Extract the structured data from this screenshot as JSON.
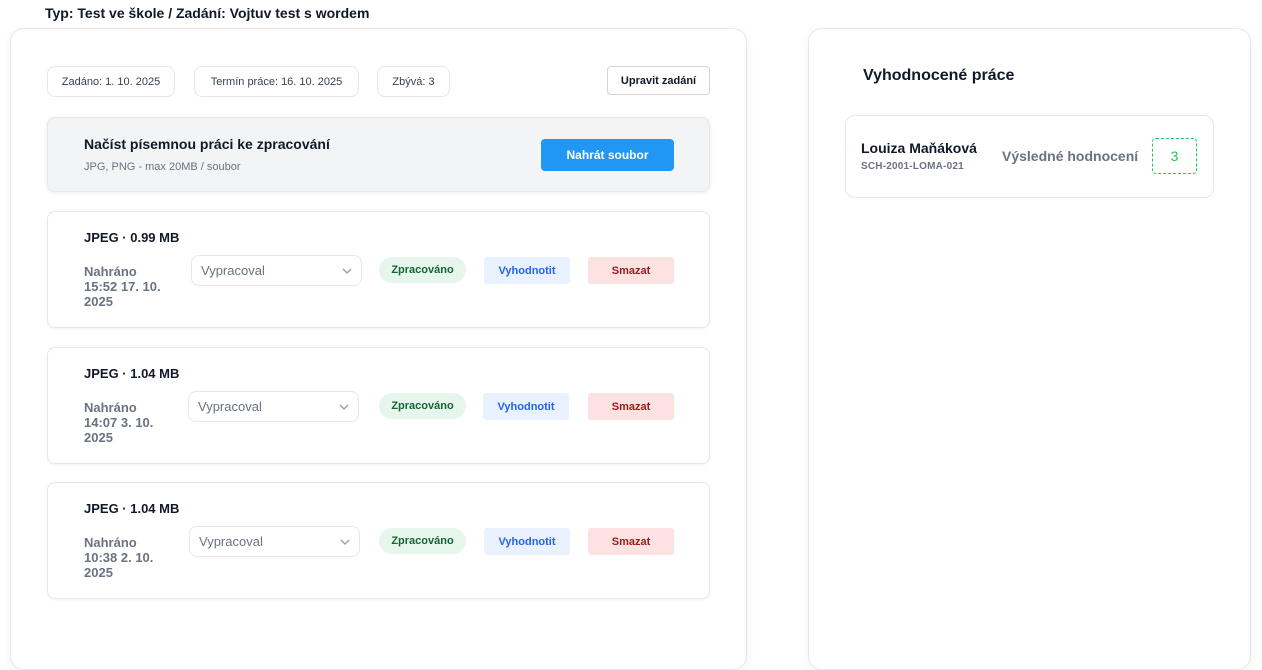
{
  "breadcrumb": "Typ: Test ve škole / Zadání: Vojtuv test s wordem",
  "assignment": {
    "assigned": "Zadáno: 1. 10. 2025",
    "deadline": "Termín práce: 16. 10. 2025",
    "remaining": "Zbývá: 3",
    "edit_label": "Upravit zadání"
  },
  "upload": {
    "title": "Načíst písemnou práci ke zpracování",
    "subtitle": "JPG, PNG - max 20MB / soubor",
    "button_label": "Nahrát soubor"
  },
  "files": [
    {
      "title": "JPEG · 0.99 MB",
      "uploaded_line1": "Nahráno",
      "uploaded_line2": "15:52 17. 10.",
      "uploaded_line3": "2025",
      "author_placeholder": "Vypracoval",
      "status": "Zpracováno",
      "evaluate_label": "Vyhodnotit",
      "delete_label": "Smazat"
    },
    {
      "title": "JPEG · 1.04 MB",
      "uploaded_line1": "Nahráno",
      "uploaded_line2": "14:07 3. 10.",
      "uploaded_line3": "2025",
      "author_placeholder": "Vypracoval",
      "status": "Zpracováno",
      "evaluate_label": "Vyhodnotit",
      "delete_label": "Smazat"
    },
    {
      "title": "JPEG · 1.04 MB",
      "uploaded_line1": "Nahráno",
      "uploaded_line2": "10:38 2. 10.",
      "uploaded_line3": "2025",
      "author_placeholder": "Vypracoval",
      "status": "Zpracováno",
      "evaluate_label": "Vyhodnotit",
      "delete_label": "Smazat"
    }
  ],
  "evaluated": {
    "title": "Vyhodnocené práce",
    "students": [
      {
        "name": "Louiza Maňáková",
        "id": "SCH-2001-LOMA-021",
        "final_label": "Výsledné hodnocení",
        "grade": "3"
      }
    ]
  },
  "colors": {
    "primary": "#2196f3",
    "success_bg": "#e6f6ec",
    "success_text": "#166534",
    "danger_bg": "#fde2e2",
    "danger_text": "#991b1b",
    "grade": "#22c55e"
  },
  "icons": {
    "select_chevron": "chevron-down-icon"
  }
}
